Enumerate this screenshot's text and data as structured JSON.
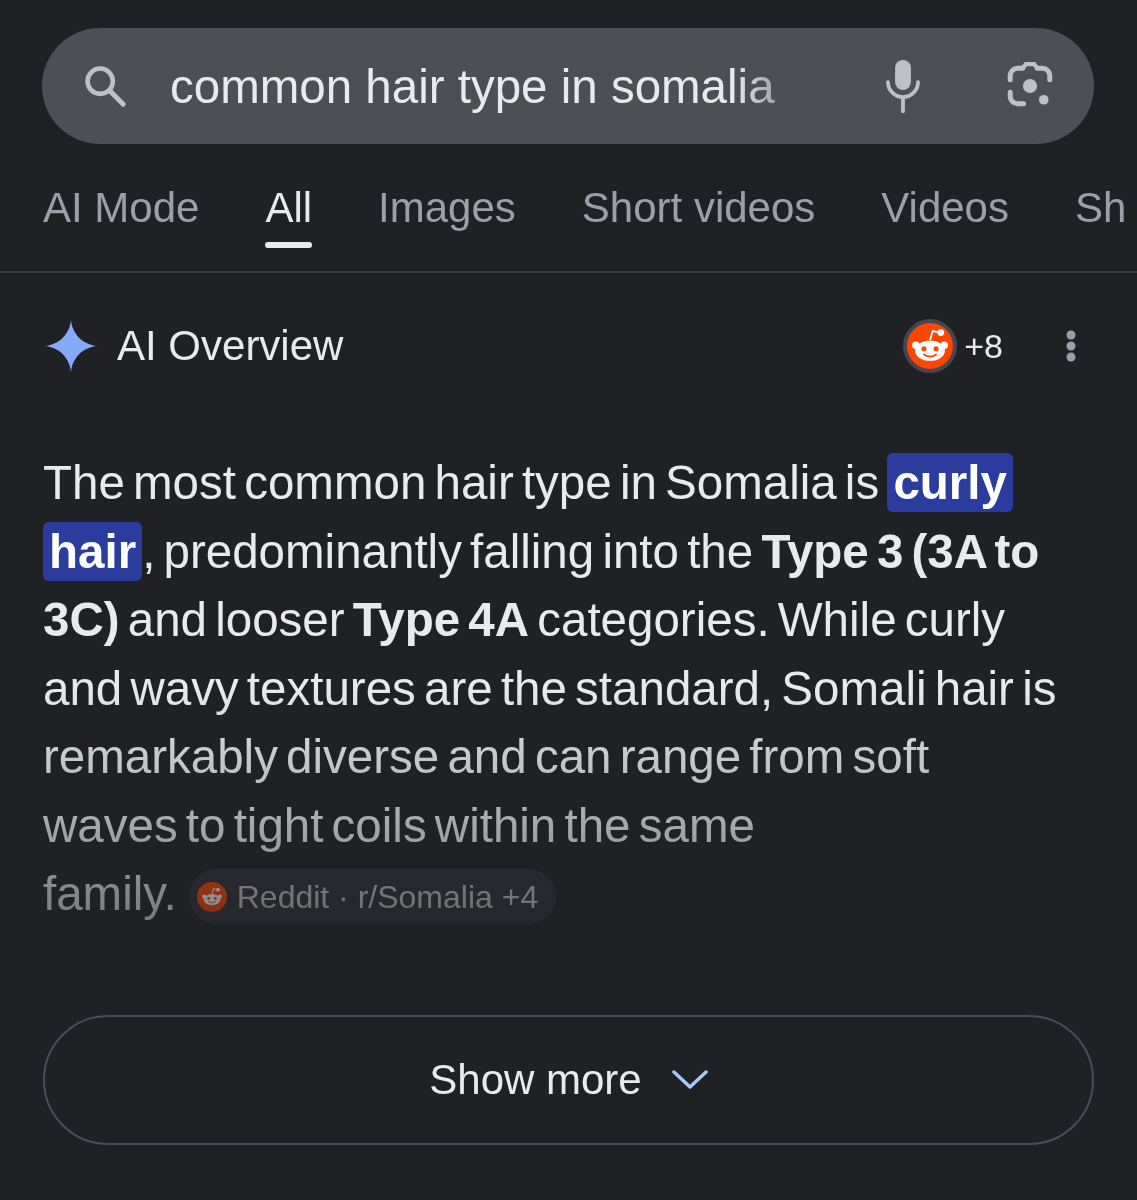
{
  "search": {
    "query": "common hair type in somalia"
  },
  "tabs": [
    {
      "label": "AI Mode",
      "selected": false
    },
    {
      "label": "All",
      "selected": true
    },
    {
      "label": "Images",
      "selected": false
    },
    {
      "label": "Short videos",
      "selected": false
    },
    {
      "label": "Videos",
      "selected": false
    },
    {
      "label": "Sh",
      "selected": false
    }
  ],
  "ai_overview": {
    "title": "AI Overview",
    "source_count": "+8",
    "answer": {
      "segments": [
        {
          "text": "The most common hair type in Somalia is ",
          "highlighted": false
        },
        {
          "text": "curly hair",
          "highlighted": true
        },
        {
          "text": ", predominantly falling into the **Type 3 (3A to 3C)** and looser **Type 4A** categories. While curly and wavy textures are the standard, Somali hair is remarkably diverse and can range from soft waves to tight coils within the same family.",
          "highlighted": false
        }
      ]
    },
    "citation": {
      "label": "Reddit · r/Somalia +4"
    },
    "show_more": {
      "label": "Show more"
    }
  }
}
